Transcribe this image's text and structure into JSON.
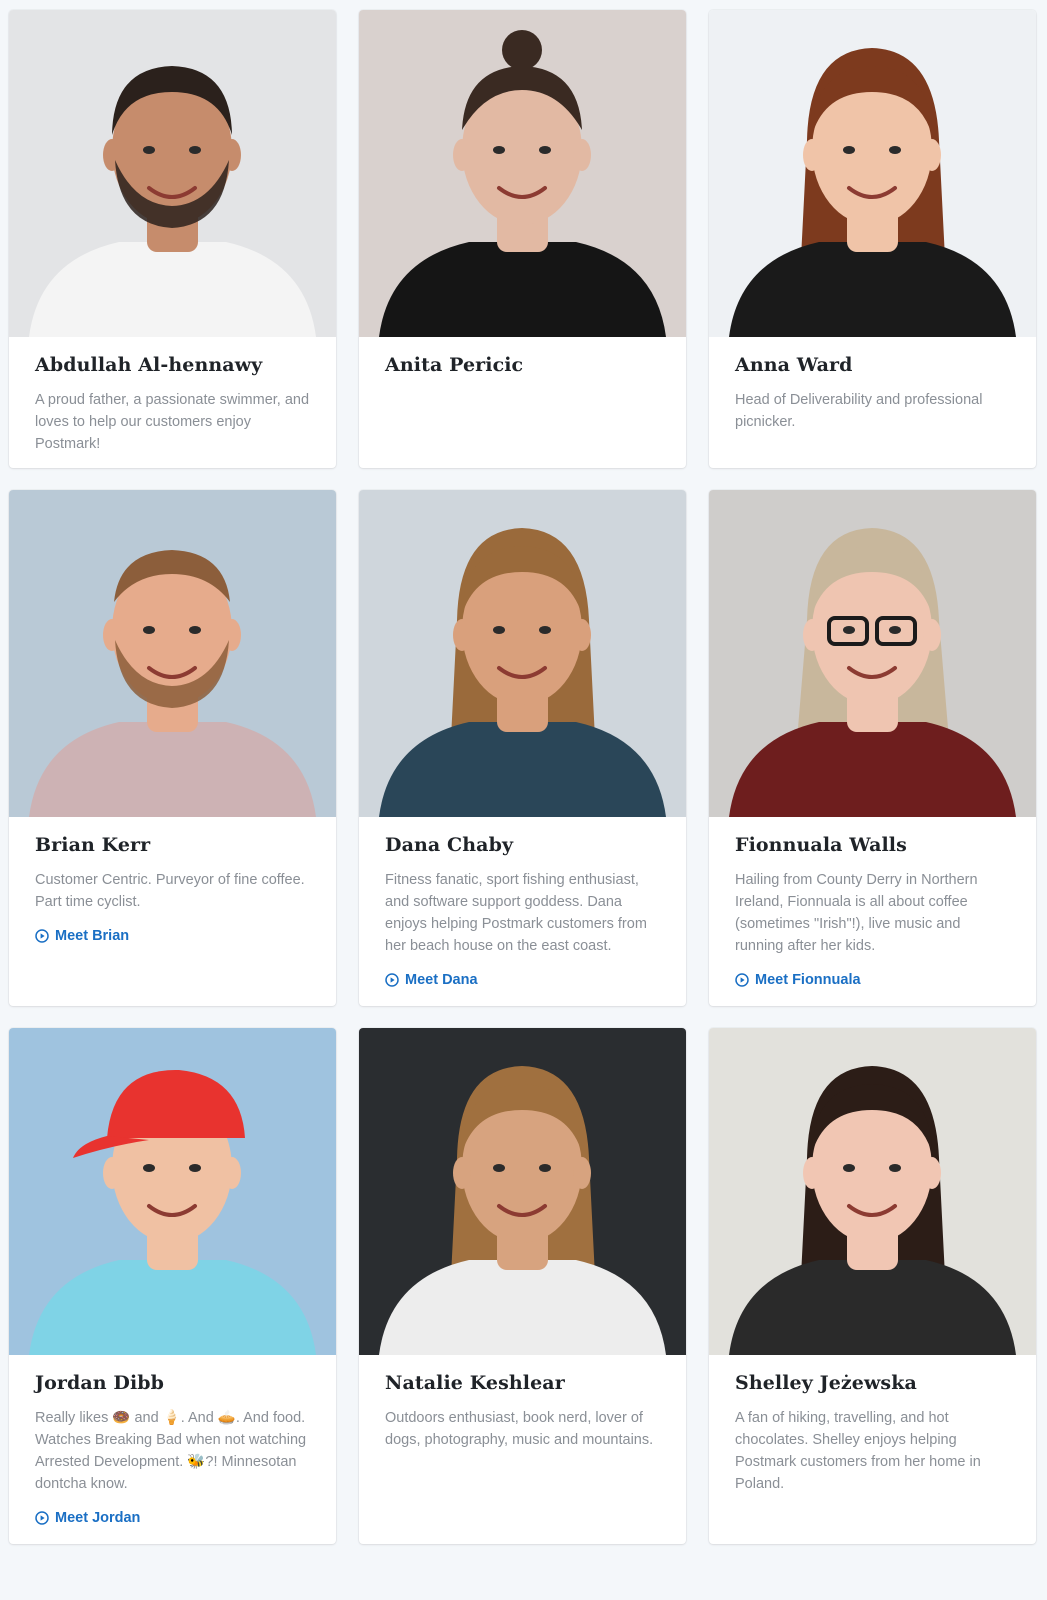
{
  "people": [
    {
      "name": "Abdullah Al-hennawy",
      "bio": "A proud father, a passionate swimmer, and loves to help our customers enjoy Postmark!",
      "link": "",
      "bg": "#e3e4e6",
      "skin": "#c68c6c",
      "hair": "#2b211c",
      "shirt": "#f4f4f4",
      "hair_style": "short-beard"
    },
    {
      "name": "Anita Pericic",
      "bio": "",
      "link": "",
      "bg": "#d9d1ce",
      "skin": "#e2b9a3",
      "hair": "#3a2a22",
      "shirt": "#151515",
      "hair_style": "bun"
    },
    {
      "name": "Anna Ward",
      "bio": "Head of Deliverability and professional picnicker.",
      "link": "",
      "bg": "#eef1f4",
      "skin": "#f0c4a8",
      "hair": "#7d3a1e",
      "shirt": "#1a1a1a",
      "hair_style": "long"
    },
    {
      "name": "Brian Kerr",
      "bio": "Customer Centric. Purveyor of fine coffee. Part time cyclist.",
      "link": "Meet Brian",
      "bg": "#b9c9d6",
      "skin": "#e6ab8c",
      "hair": "#8c5e3b",
      "shirt": "#cdb2b4",
      "hair_style": "buzz-beard"
    },
    {
      "name": "Dana Chaby",
      "bio": "Fitness fanatic, sport fishing enthusiast, and software support goddess. Dana enjoys helping Postmark customers from her beach house on the east coast.",
      "link": "Meet Dana",
      "bg": "#cfd6dc",
      "skin": "#d9a07c",
      "hair": "#9a6a3b",
      "shirt": "#2a4658",
      "hair_style": "long-wavy"
    },
    {
      "name": "Fionnuala Walls",
      "bio": "Hailing from County Derry in Northern Ireland, Fionnuala is all about coffee (sometimes \"Irish\"!), live music and running after her kids.",
      "link": "Meet Fionnuala",
      "bg": "#cfcdcb",
      "skin": "#efc5b1",
      "hair": "#c8b79c",
      "shirt": "#6e1e1e",
      "hair_style": "bob-glasses"
    },
    {
      "name": "Jordan Dibb",
      "bio": "Really likes 🍩 and 🍦. And 🥧. And food. Watches Breaking Bad when not watching Arrested Development. 🐝?! Minnesotan dontcha know.",
      "link": "Meet Jordan",
      "bg": "#9fc3df",
      "skin": "#f0c1a3",
      "hair": "#e8332f",
      "shirt": "#7fd3e6",
      "hair_style": "cap"
    },
    {
      "name": "Natalie Keshlear",
      "bio": "Outdoors enthusiast, book nerd, lover of dogs, photography, music and mountains.",
      "link": "",
      "bg": "#2a2d30",
      "skin": "#d7a37f",
      "hair": "#a0703f",
      "shirt": "#ededed",
      "hair_style": "long-wavy"
    },
    {
      "name": "Shelley Jeżewska",
      "bio": "A fan of hiking, travelling, and hot chocolates. Shelley enjoys helping Postmark customers from her home in Poland.",
      "link": "",
      "bg": "#e2e1dc",
      "skin": "#f1c6b3",
      "hair": "#2c1d17",
      "shirt": "#2a2a2a",
      "hair_style": "long"
    }
  ],
  "icons": {
    "meet": "play-circle-icon"
  },
  "colors": {
    "link": "#1a6fc4",
    "name": "#1f2328",
    "bio": "#8a8f96",
    "page_bg": "#f4f7fa"
  }
}
